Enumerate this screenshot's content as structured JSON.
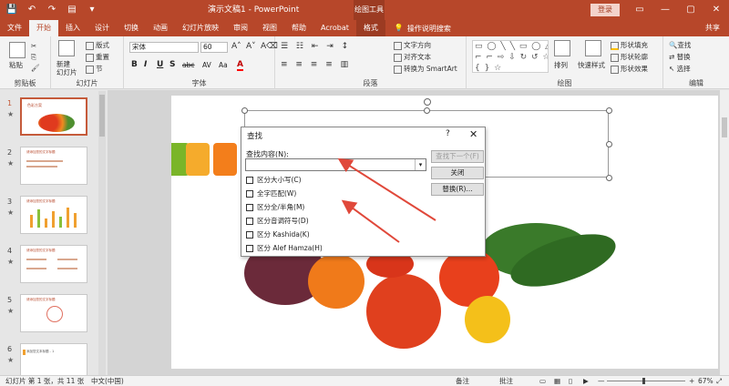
{
  "titlebar": {
    "qat": [
      "💾",
      "↶",
      "↷",
      "▤",
      "▾"
    ],
    "doc_title": "演示文稿1 - PowerPoint",
    "context_tools": "绘图工具",
    "login": "登录",
    "win_controls": [
      "▭",
      "—",
      "▢",
      "✕"
    ]
  },
  "tabs": {
    "items": [
      "文件",
      "开始",
      "插入",
      "设计",
      "切换",
      "动画",
      "幻灯片放映",
      "审阅",
      "视图",
      "帮助",
      "Acrobat",
      "格式"
    ],
    "tell_me": "操作说明搜索",
    "share": "共享"
  },
  "ribbon": {
    "clipboard": {
      "label": "剪贴板",
      "paste": "粘贴"
    },
    "slides": {
      "label": "幻灯片",
      "new_slide": "新建\n幻灯片",
      "layout": "版式",
      "reset": "重置",
      "section": "节"
    },
    "font": {
      "label": "字体",
      "font_name": "宋体",
      "font_size": "60",
      "bold": "B",
      "italic": "I",
      "underline": "U",
      "strike": "S",
      "shadow": "abc",
      "spacing": "AV",
      "case": "Aa",
      "color": "A"
    },
    "paragraph": {
      "label": "段落",
      "text_direction": "文字方向",
      "align_text": "对齐文本",
      "smartart": "转换为 SmartArt"
    },
    "drawing": {
      "label": "绘图",
      "shapes": "▭ ◯ ╲ ╲ ▭ ◯ △ ⌐\n⌐ ⌐ ⇨ ⇩ ↻ ↺ ☆ ▾\n{ } ☆",
      "arrange": "排列",
      "quick_styles": "快速样式",
      "fill": "形状填充",
      "outline": "形状轮廓",
      "effects": "形状效果"
    },
    "editing": {
      "label": "编辑",
      "find": "查找",
      "replace": "替换",
      "select": "选择"
    }
  },
  "thumbs": [
    {
      "num": "1",
      "star": "★",
      "title": "色彩方案"
    },
    {
      "num": "2",
      "star": "★",
      "title": "请添加您的文字标题"
    },
    {
      "num": "3",
      "star": "★",
      "title": "请添加您的文字标题"
    },
    {
      "num": "4",
      "star": "★",
      "title": "请添加您的文字标题"
    },
    {
      "num": "5",
      "star": "★",
      "title": "请添加您的文字标题"
    },
    {
      "num": "6",
      "star": "★",
      "title": "添加您文本标题 - 1"
    }
  ],
  "slide": {
    "squares": [
      "#7ab529",
      "#f5ab2c",
      "#f37e1b"
    ]
  },
  "dialog": {
    "title": "查找",
    "help": "?",
    "close": "✕",
    "find_label": "查找内容(N):",
    "find_value": "",
    "buttons": {
      "find_next": "查找下一个(F)",
      "close": "关闭",
      "replace": "替换(R)..."
    },
    "options": [
      "区分大小写(C)",
      "全字匹配(W)",
      "区分全/半角(M)",
      "区分音调符号(D)",
      "区分 Kashida(K)",
      "区分 Alef Hamza(H)"
    ]
  },
  "status": {
    "slide_info": "幻灯片 第 1 张，共 11 张",
    "language": "中文(中国)",
    "notes": "备注",
    "comments": "批注",
    "zoom": "67%",
    "minus": "—",
    "plus": "+"
  },
  "colors": {
    "accent": "#b7472a",
    "arrow": "#e0483a"
  }
}
